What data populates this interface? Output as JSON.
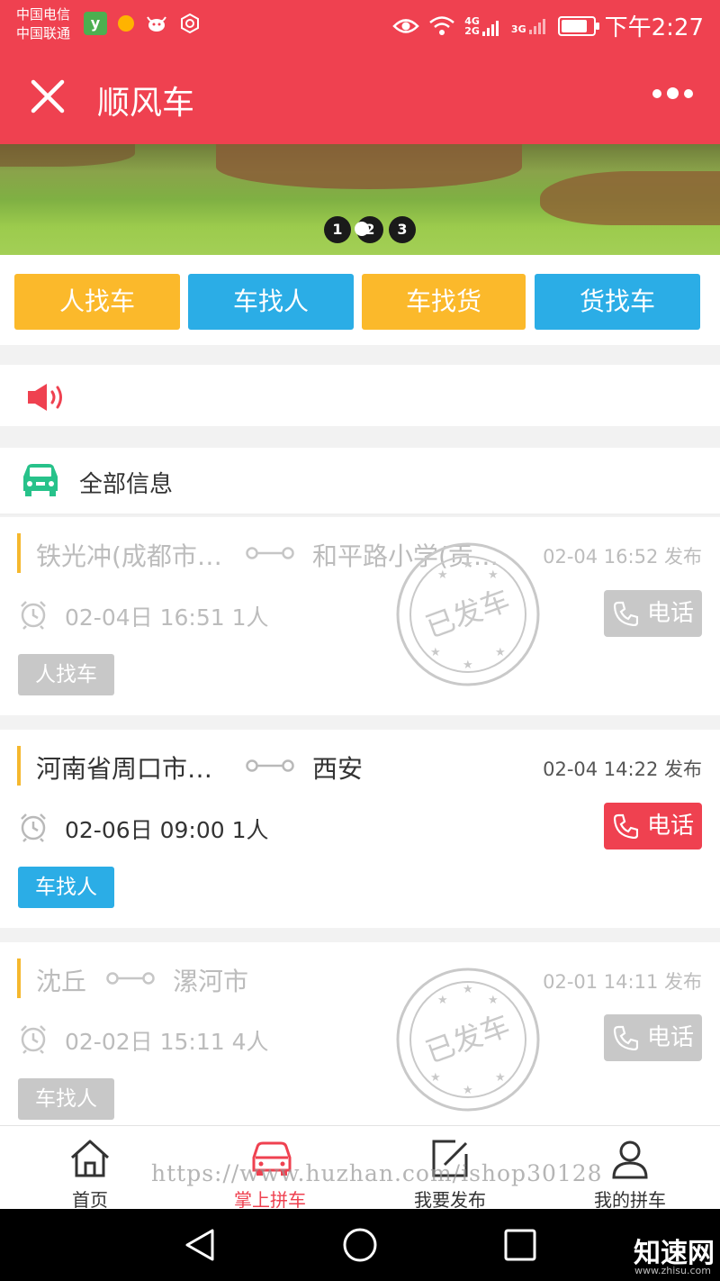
{
  "status_bar": {
    "carrier1": "中国电信",
    "carrier2": "中国联通",
    "network1": "4G",
    "network2": "2G",
    "network3": "3G",
    "time": "下午2:27"
  },
  "nav": {
    "title": "顺风车"
  },
  "banner": {
    "pages": [
      "1",
      "2",
      "3"
    ],
    "active_page": 2
  },
  "categories": [
    {
      "label": "人找车",
      "color": "#fbb92b"
    },
    {
      "label": "车找人",
      "color": "#2bade6"
    },
    {
      "label": "车找货",
      "color": "#fbb92b"
    },
    {
      "label": "货找车",
      "color": "#2bade6"
    }
  ],
  "list_header": {
    "title": "全部信息"
  },
  "trips": [
    {
      "from": "铁光冲(成都市…",
      "to": "和平路小学(贡…",
      "published": "02-04 16:52 发布",
      "when": "02-04日 16:51 1人",
      "call_label": "电话",
      "tag": "人找车",
      "status": "done",
      "stamp": "已发车"
    },
    {
      "from": "河南省周口市…",
      "to": "西安",
      "published": "02-04 14:22 发布",
      "when": "02-06日 09:00 1人",
      "call_label": "电话",
      "tag": "车找人",
      "status": "active"
    },
    {
      "from": "沈丘",
      "to": "漯河市",
      "published": "02-01 14:11 发布",
      "when": "02-02日 15:11 4人",
      "call_label": "电话",
      "tag": "车找人",
      "status": "done",
      "stamp": "已发车"
    }
  ],
  "colors": {
    "brand": "#ef4150",
    "call_active": "#ef4150",
    "call_done": "#c8c8c8",
    "tag_active": "#2bade6",
    "tag_done": "#c8c8c8",
    "accent_bar": "#f5b82e",
    "car_icon": "#27c28a"
  },
  "tabs": [
    {
      "label": "首页",
      "icon": "home-icon"
    },
    {
      "label": "掌上拼车",
      "icon": "car-icon",
      "active": true
    },
    {
      "label": "我要发布",
      "icon": "edit-icon"
    },
    {
      "label": "我的拼车",
      "icon": "user-icon"
    }
  ],
  "watermark": "https://www.huzhan.com/ishop30128",
  "brand": {
    "name": "知速网",
    "url": "www.zhisu.com"
  }
}
